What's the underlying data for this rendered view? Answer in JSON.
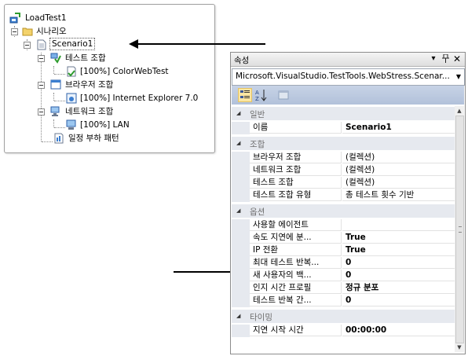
{
  "tree": {
    "root": "LoadTest1",
    "scenarios_folder": "시나리오",
    "scenario": "Scenario1",
    "test_mix": "테스트 조합",
    "test_item": "[100%] ColorWebTest",
    "browser_mix": "브라우저 조합",
    "browser_item": "[100%] Internet Explorer 7.0",
    "network_mix": "네트워크 조합",
    "network_item": "[100%] LAN",
    "load_pattern": "일정 부하 패턴"
  },
  "properties": {
    "title": "속성",
    "title_buttons": [
      "▾",
      "📌",
      "✕"
    ],
    "object_selector": "Microsoft.VisualStudio.TestTools.WebStress.Scenar...",
    "categories": [
      {
        "label": "일반",
        "rows": [
          {
            "name": "이름",
            "value": "Scenario1",
            "bold": true
          }
        ]
      },
      {
        "label": "조합",
        "rows": [
          {
            "name": "브라우저 조합",
            "value": "(컬렉션)",
            "bold": false
          },
          {
            "name": "네트워크 조합",
            "value": "(컬렉션)",
            "bold": false
          },
          {
            "name": "테스트 조합",
            "value": "(컬렉션)",
            "bold": false
          },
          {
            "name": "테스트 조합 유형",
            "value": "총 테스트 횟수 기반",
            "bold": false
          }
        ]
      },
      {
        "label": "옵션",
        "rows": [
          {
            "name": "사용할 에이전트",
            "value": "",
            "bold": false
          },
          {
            "name": "속도 지연에 분...",
            "value": "True",
            "bold": true
          },
          {
            "name": "IP 전환",
            "value": "True",
            "bold": true
          },
          {
            "name": "최대 테스트 반복...",
            "value": "0",
            "bold": true
          },
          {
            "name": "새 사용자의 백...",
            "value": "0",
            "bold": true
          },
          {
            "name": "인지 시간 프로필",
            "value": "정규 분포",
            "bold": true
          },
          {
            "name": "테스트 반복 간...",
            "value": "0",
            "bold": true
          }
        ]
      },
      {
        "label": "타이밍",
        "rows": [
          {
            "name": "지연 시작 시간",
            "value": "00:00:00",
            "bold": true
          }
        ]
      }
    ]
  },
  "colors": {
    "toolbar": "#b2c1da",
    "category_bg": "#e6e9ef",
    "selected_button": "#fbe6a2"
  }
}
